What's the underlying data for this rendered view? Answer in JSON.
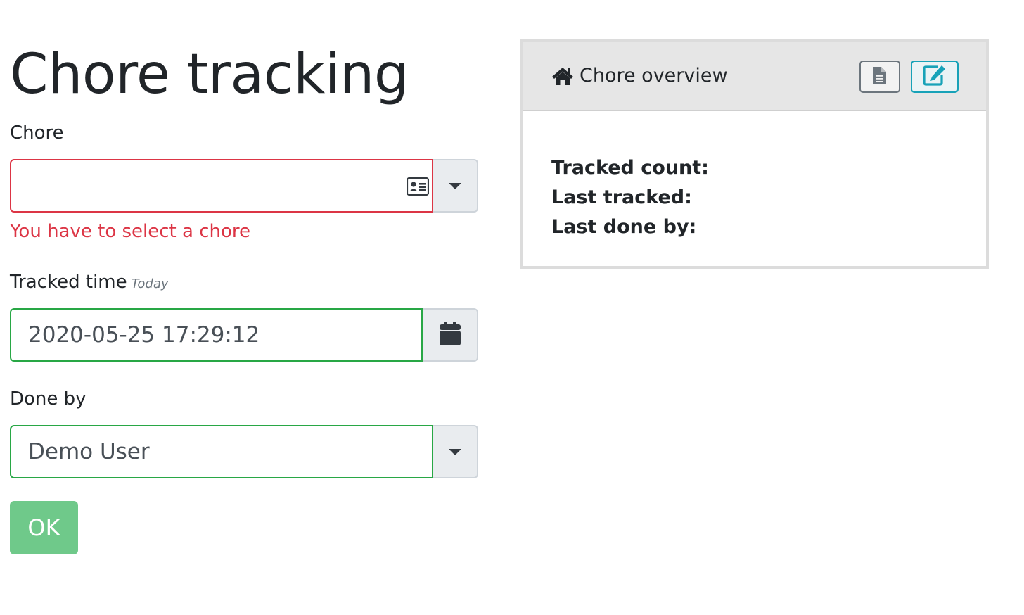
{
  "page": {
    "title": "Chore tracking"
  },
  "form": {
    "chore": {
      "label": "Chore",
      "value": "",
      "error": "You have to select a chore"
    },
    "tracked_time": {
      "label": "Tracked time",
      "hint": "Today",
      "value": "2020-05-25 17:29:12"
    },
    "done_by": {
      "label": "Done by",
      "value": "Demo User"
    },
    "submit_label": "OK"
  },
  "overview": {
    "title": "Chore overview",
    "tracked_count_label": "Tracked count:",
    "last_tracked_label": "Last tracked:",
    "last_done_by_label": "Last done by:"
  },
  "colors": {
    "invalid": "#dc3545",
    "valid": "#28a745",
    "ok_button": "#6fc98a",
    "edit_accent": "#17a2b8"
  },
  "icons": {
    "chore_field": "id-card-icon",
    "tracked_time_addon": "calendar-icon",
    "overview_title": "home-icon",
    "overview_journal": "file-icon",
    "overview_edit": "edit-icon"
  }
}
